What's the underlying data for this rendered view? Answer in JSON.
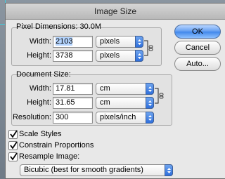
{
  "dialog": {
    "title": "Image Size",
    "buttons": {
      "ok": "OK",
      "cancel": "Cancel",
      "auto": "Auto..."
    }
  },
  "pixel_dimensions": {
    "legend": "Pixel Dimensions:",
    "size": "30.0M",
    "width": {
      "label": "Width:",
      "value": "2103",
      "unit": "pixels"
    },
    "height": {
      "label": "Height:",
      "value": "3738",
      "unit": "pixels"
    }
  },
  "document_size": {
    "legend": "Document Size:",
    "width": {
      "label": "Width:",
      "value": "17.81",
      "unit": "cm"
    },
    "height": {
      "label": "Height:",
      "value": "31.65",
      "unit": "cm"
    },
    "resolution": {
      "label": "Resolution:",
      "value": "300",
      "unit": "pixels/inch"
    }
  },
  "options": {
    "scale_styles": {
      "label": "Scale Styles",
      "checked": true
    },
    "constrain_proportions": {
      "label": "Constrain Proportions",
      "checked": true
    },
    "resample_image": {
      "label": "Resample Image:",
      "checked": true
    },
    "resample_method": "Bicubic (best for smooth gradients)"
  },
  "colors": {
    "accent": "#3f85ea",
    "guides": "#3fd0e0"
  }
}
